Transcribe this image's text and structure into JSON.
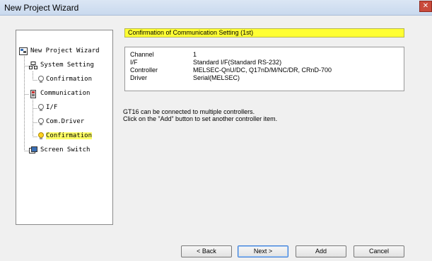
{
  "window": {
    "title": "New Project Wizard",
    "close_glyph": "✕"
  },
  "tree": {
    "items": [
      {
        "label": "New Project Wizard",
        "icon": "project-icon"
      },
      {
        "label": "System Setting",
        "icon": "system-icon"
      },
      {
        "label": "Confirmation",
        "icon": "bulb-icon"
      },
      {
        "label": "Communication",
        "icon": "communication-icon"
      },
      {
        "label": "I/F",
        "icon": "bulb-icon"
      },
      {
        "label": "Com.Driver",
        "icon": "bulb-icon"
      },
      {
        "label": "Confirmation",
        "icon": "bulb-icon",
        "selected": true
      },
      {
        "label": "Screen Switch",
        "icon": "screen-icon"
      }
    ]
  },
  "main": {
    "header": "Confirmation of Communication Setting (1st)",
    "settings": [
      {
        "key": "Channel",
        "value": "1"
      },
      {
        "key": "I/F",
        "value": "Standard I/F(Standard RS-232)"
      },
      {
        "key": "Controller",
        "value": "MELSEC-QnU/DC, Q17nD/M/NC/DR, CRnD-700"
      },
      {
        "key": "Driver",
        "value": "Serial(MELSEC)"
      }
    ],
    "message_line1": "GT16 can be connected to multiple controllers.",
    "message_line2": "Click on the ”Add” button to set another controller item."
  },
  "buttons": {
    "back": "< Back",
    "next": "Next >",
    "add": "Add",
    "cancel": "Cancel"
  },
  "colors": {
    "highlight": "#ffff33",
    "selection": "#ffff66"
  }
}
